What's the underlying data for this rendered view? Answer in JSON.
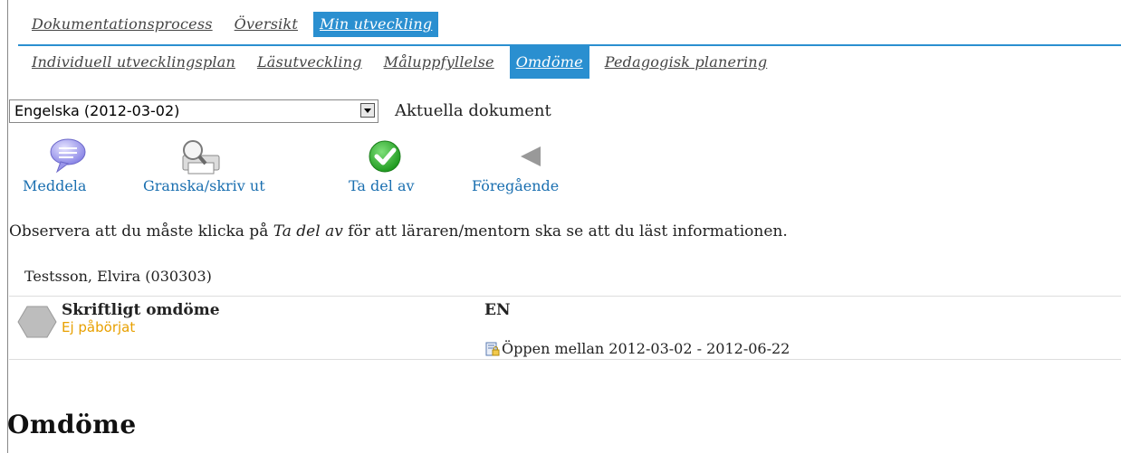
{
  "tabs_top": [
    {
      "label": "Dokumentationsprocess",
      "active": false
    },
    {
      "label": "Översikt",
      "active": false
    },
    {
      "label": "Min utveckling",
      "active": true
    }
  ],
  "tabs_sub": [
    {
      "label": "Individuell utvecklingsplan",
      "active": false
    },
    {
      "label": "Läsutveckling",
      "active": false
    },
    {
      "label": "Måluppfyllelse",
      "active": false
    },
    {
      "label": "Omdöme",
      "active": true
    },
    {
      "label": "Pedagogisk planering",
      "active": false
    }
  ],
  "document_select": {
    "selected": "Engelska (2012-03-02)"
  },
  "current_docs_label": "Aktuella dokument",
  "toolbar": {
    "message_label": "Meddela",
    "preview_label": "Granska/skriv ut",
    "ack_label": "Ta del av",
    "previous_label": "Föregående"
  },
  "notice": {
    "before": "Observera att du måste klicka på ",
    "emph": "Ta del av",
    "after": " för att läraren/mentorn ska se att du läst informationen."
  },
  "student_name": "Testsson, Elvira (030303)",
  "assessment": {
    "title": "Skriftligt omdöme",
    "status": "Ej påbörjat",
    "subject": "EN",
    "open_period": "Öppen mellan 2012-03-02 - 2012-06-22"
  },
  "section_heading": "Omdöme",
  "colors": {
    "accent": "#2a8fd0",
    "status": "#e8a000",
    "link": "#1a6fb0"
  },
  "icons": [
    "speech-bubble-icon",
    "printer-preview-icon",
    "check-icon",
    "previous-arrow-icon",
    "lock-document-icon",
    "status-hexagon-icon"
  ]
}
